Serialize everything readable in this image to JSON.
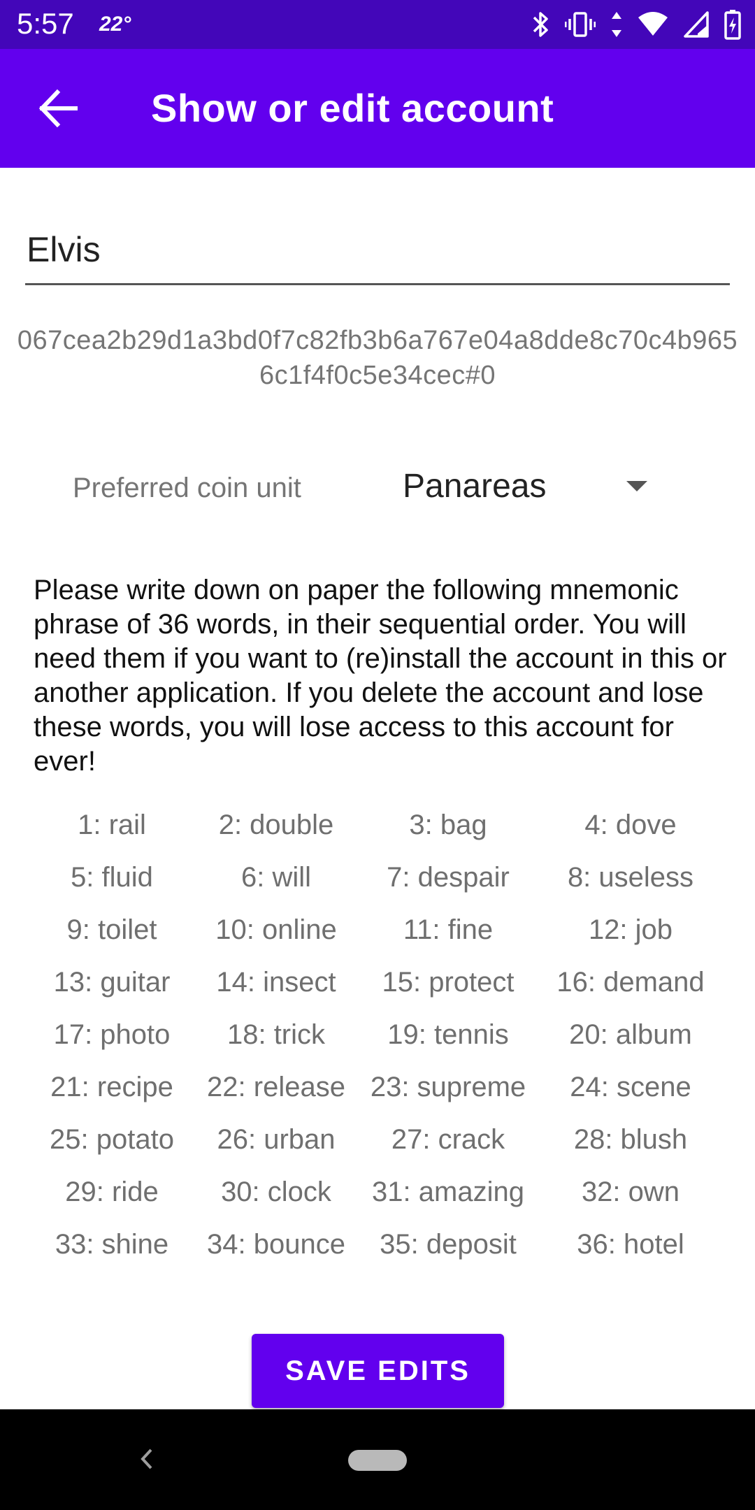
{
  "status_bar": {
    "time": "5:57",
    "temperature": "22°",
    "icons": [
      "bluetooth-icon",
      "vibrate-icon",
      "data-arrows-icon",
      "wifi-icon",
      "signal-icon",
      "battery-charging-icon"
    ]
  },
  "app_bar": {
    "title": "Show or edit account",
    "back_icon": "arrow-back-icon",
    "background": "#6200ee"
  },
  "account": {
    "name": "Elvis",
    "key": "067cea2b29d1a3bd0f7c82fb3b6a767e04a8dde8c70c4b9656c1f4f0c5e34cec#0"
  },
  "coin_unit": {
    "label": "Preferred coin unit",
    "selected": "Panareas"
  },
  "instructions": "Please write down on paper the following mnemonic phrase of 36 words, in their sequential order. You will need them if you want to (re)install the account in this or another application. If you delete the account and lose these words, you will lose access to this account for ever!",
  "mnemonic": [
    "1: rail",
    "2: double",
    "3: bag",
    "4: dove",
    "5: fluid",
    "6: will",
    "7: despair",
    "8: useless",
    "9: toilet",
    "10: online",
    "11: fine",
    "12: job",
    "13: guitar",
    "14: insect",
    "15: protect",
    "16: demand",
    "17: photo",
    "18: trick",
    "19: tennis",
    "20: album",
    "21: recipe",
    "22: release",
    "23: supreme",
    "24: scene",
    "25: potato",
    "26: urban",
    "27: crack",
    "28: blush",
    "29: ride",
    "30: clock",
    "31: amazing",
    "32: own",
    "33: shine",
    "34: bounce",
    "35: deposit",
    "36: hotel"
  ],
  "save_button": {
    "label": "SAVE EDITS"
  },
  "colors": {
    "status_bar": "#4306b9",
    "accent": "#6200ee",
    "secondary_text": "#757575"
  }
}
